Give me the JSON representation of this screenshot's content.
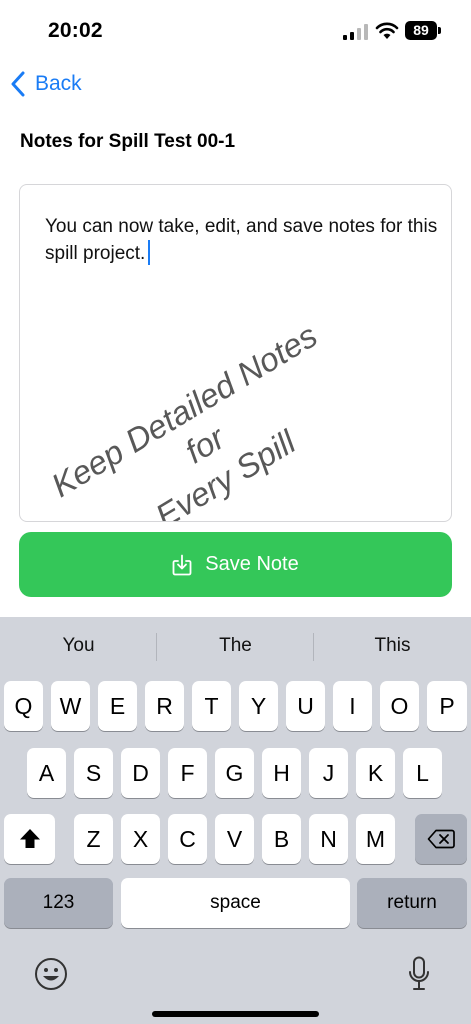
{
  "status_bar": {
    "time": "20:02",
    "battery": "89"
  },
  "nav": {
    "back_label": "Back"
  },
  "page": {
    "title": "Notes for Spill Test 00-1"
  },
  "note": {
    "text": "You can now take, edit, and save notes for this spill project.",
    "watermark_line1": "Keep Detailed Notes for",
    "watermark_line2": "Every Spill"
  },
  "save_button": {
    "label": "Save Note"
  },
  "keyboard": {
    "suggestions": [
      "You",
      "The",
      "This"
    ],
    "row1": [
      "Q",
      "W",
      "E",
      "R",
      "T",
      "Y",
      "U",
      "I",
      "O",
      "P"
    ],
    "row2": [
      "A",
      "S",
      "D",
      "F",
      "G",
      "H",
      "J",
      "K",
      "L"
    ],
    "row3": [
      "Z",
      "X",
      "C",
      "V",
      "B",
      "N",
      "M"
    ],
    "numbers_label": "123",
    "space_label": "space",
    "return_label": "return"
  },
  "colors": {
    "accent": "#1a7cf5",
    "save_green": "#34c759",
    "keyboard_bg": "#d1d4db"
  },
  "icons": [
    "signal-icon",
    "wifi-icon",
    "battery-icon",
    "chevron-left-icon",
    "save-download-icon",
    "shift-icon",
    "delete-icon",
    "emoji-icon",
    "microphone-icon"
  ]
}
